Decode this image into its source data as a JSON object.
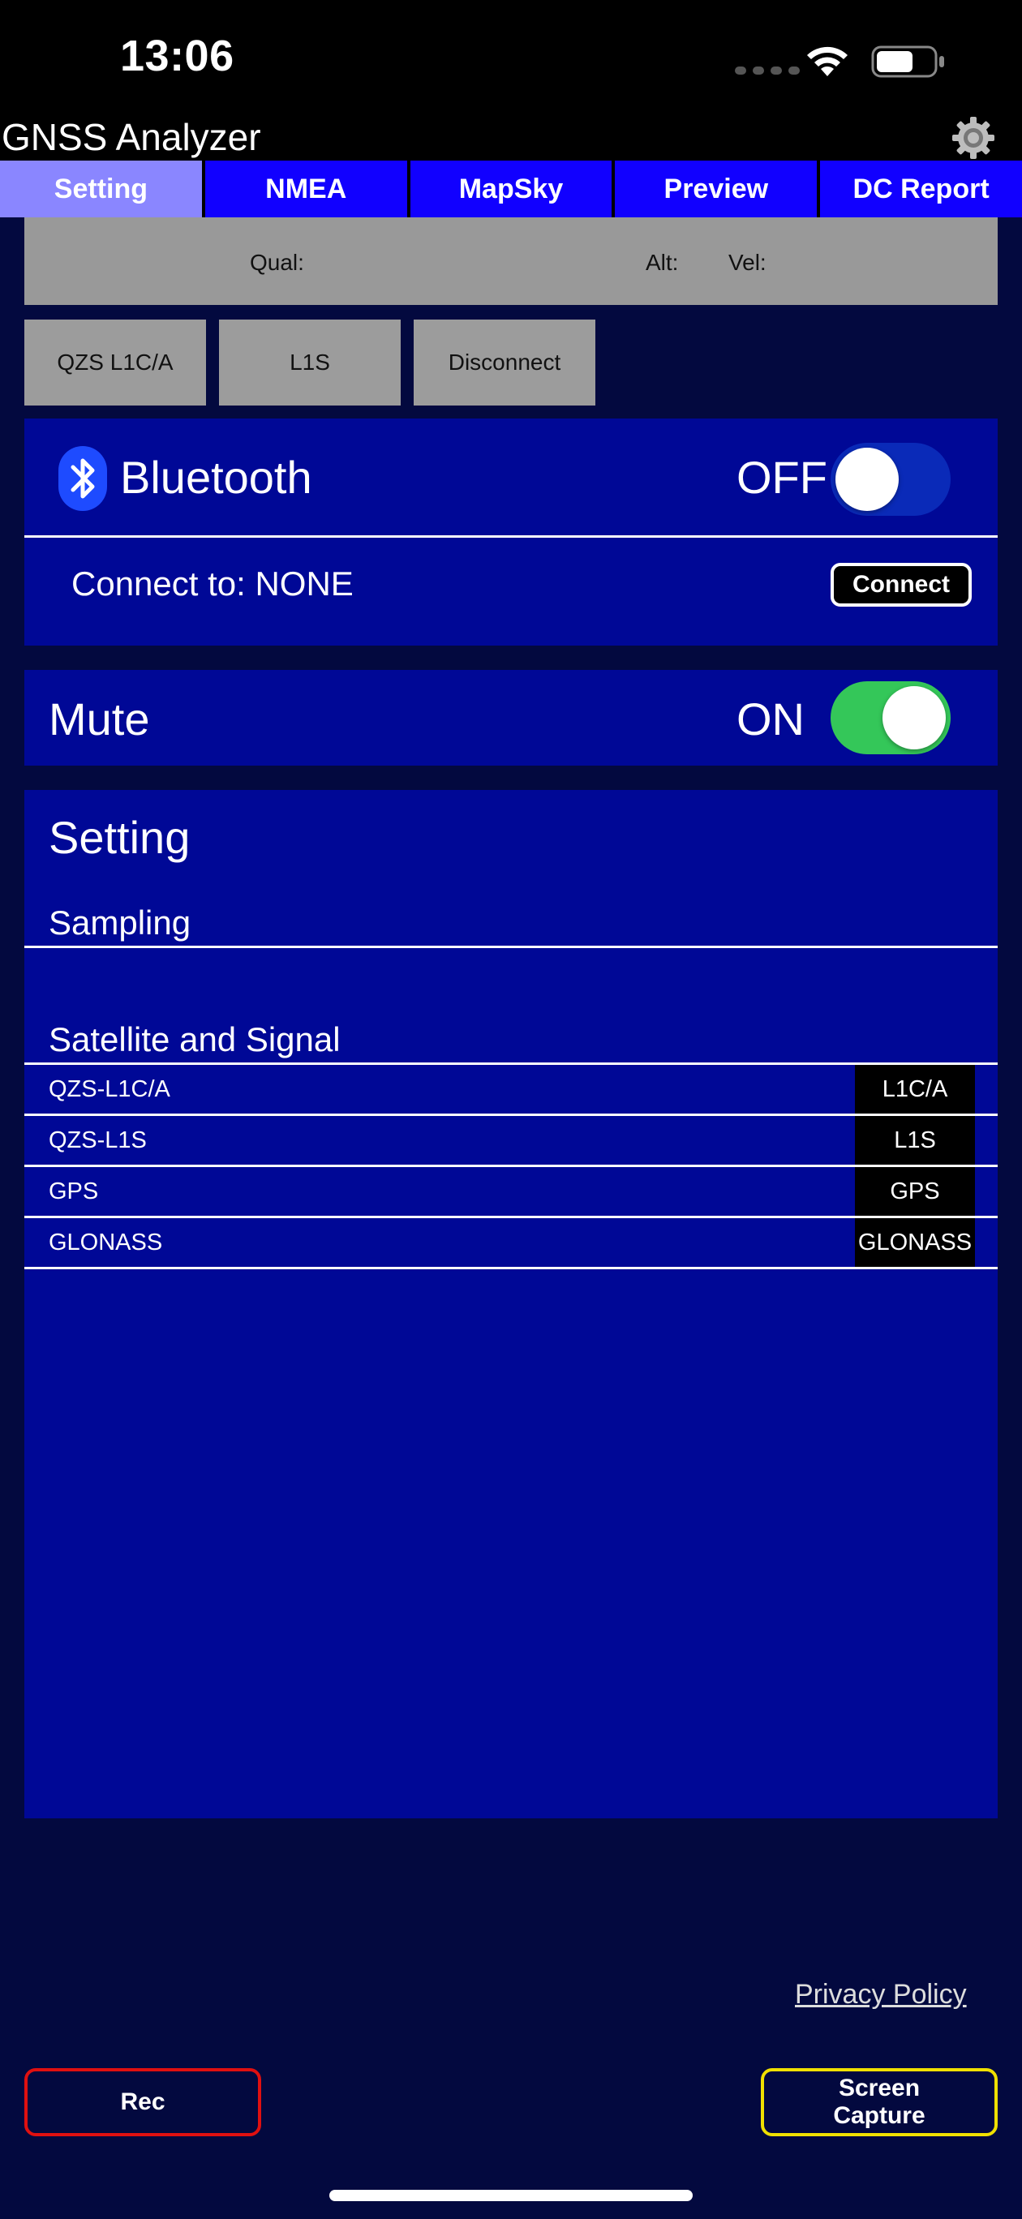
{
  "status_bar": {
    "time": "13:06"
  },
  "header": {
    "app_title": "GNSS Analyzer"
  },
  "tabs": [
    {
      "label": "Setting",
      "active": true
    },
    {
      "label": "NMEA",
      "active": false
    },
    {
      "label": "MapSky",
      "active": false
    },
    {
      "label": "Preview",
      "active": false
    },
    {
      "label": "DC Report",
      "active": false
    }
  ],
  "info_bar": {
    "qual_label": "Qual:",
    "alt_label": "Alt:",
    "vel_label": "Vel:"
  },
  "signal_buttons": {
    "qzs_l1ca": "QZS L1C/A",
    "l1s": "L1S",
    "disconnect": "Disconnect"
  },
  "bluetooth": {
    "label": "Bluetooth",
    "state": "OFF",
    "enabled": false,
    "connect_to": "Connect to: NONE",
    "connect_button": "Connect"
  },
  "mute": {
    "label": "Mute",
    "state": "ON",
    "enabled": true
  },
  "setting": {
    "title": "Setting",
    "sampling_title": "Sampling",
    "satellite_title": "Satellite and Signal",
    "signals": [
      {
        "name": "QZS-L1C/A",
        "tag": "L1C/A"
      },
      {
        "name": "QZS-L1S",
        "tag": "L1S"
      },
      {
        "name": "GPS",
        "tag": "GPS"
      },
      {
        "name": "GLONASS",
        "tag": "GLONASS"
      }
    ]
  },
  "footer": {
    "privacy_link": "Privacy Policy",
    "rec_button": "Rec",
    "capture_button": "Screen\nCapture"
  },
  "colors": {
    "background": "#03093f",
    "panel": "#000896",
    "tab": "#1100ff",
    "tab_active": "#8a86ff",
    "switch_on": "#34c759",
    "rec_border": "#e01010",
    "capture_border": "#f0e000"
  }
}
